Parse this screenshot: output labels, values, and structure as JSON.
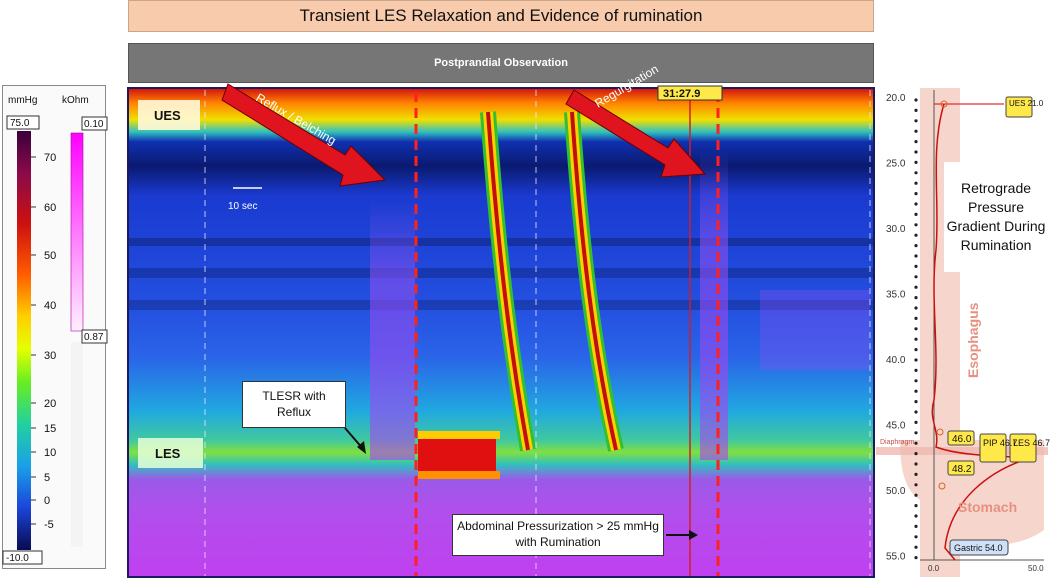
{
  "banner": {
    "title": "Transient LES Relaxation and Evidence of rumination"
  },
  "subbar": {
    "title": "Postprandial Observation"
  },
  "colorbar": {
    "left_unit": "mmHg",
    "right_unit": "kOhm",
    "max_label": "75.0",
    "min_label": "-10.0",
    "ticks": [
      "70",
      "60",
      "50",
      "40",
      "30",
      "20",
      "15",
      "10",
      "5",
      "0",
      "-5"
    ],
    "imp_top": "0.10",
    "imp_bottom": "0.87"
  },
  "plot": {
    "ues_label": "UES",
    "les_label": "LES",
    "scale_label": "10 sec",
    "timestamp": "31:27.9",
    "arrow1_text": "Reflux / Belching",
    "arrow2_text": "Regurgitation"
  },
  "callouts": {
    "tlesr": "TLESR with Reflux",
    "abdominal": "Abdominal Pressurization > 25 mmHg with Rumination"
  },
  "profile": {
    "y_ticks": [
      "20.0",
      "25.0",
      "30.0",
      "35.0",
      "40.0",
      "45.0",
      "50.0",
      "55.0"
    ],
    "x_ticks": [
      "0.0",
      "50.0"
    ],
    "ues_tag": "UES 21.0",
    "les_tag": "LES 46.7",
    "pip_tag": "PIP 46.7",
    "v460": "46.0",
    "v482": "48.2",
    "gastric": "Gastric 54.0",
    "esophagus": "Esophagus",
    "stomach": "Stomach",
    "diaphragm": "Diaphragm",
    "annotation": "Retrograde Pressure Gradient During Rumination"
  },
  "colors": {
    "banner": "#f8cbad",
    "subbar": "#767676",
    "arrow": "#e0141e",
    "dashed": "#ff2020"
  },
  "chart_data": {
    "type": "heatmap",
    "title": "Transient LES Relaxation and Evidence of rumination",
    "colorscale_range": [
      -10,
      75
    ],
    "colorscale_unit": "mmHg",
    "impedance_range": [
      0.1,
      0.87
    ],
    "impedance_unit": "kOhm",
    "position_range_cm": [
      20,
      55
    ],
    "events": [
      "Reflux / Belching",
      "Regurgitation"
    ]
  }
}
